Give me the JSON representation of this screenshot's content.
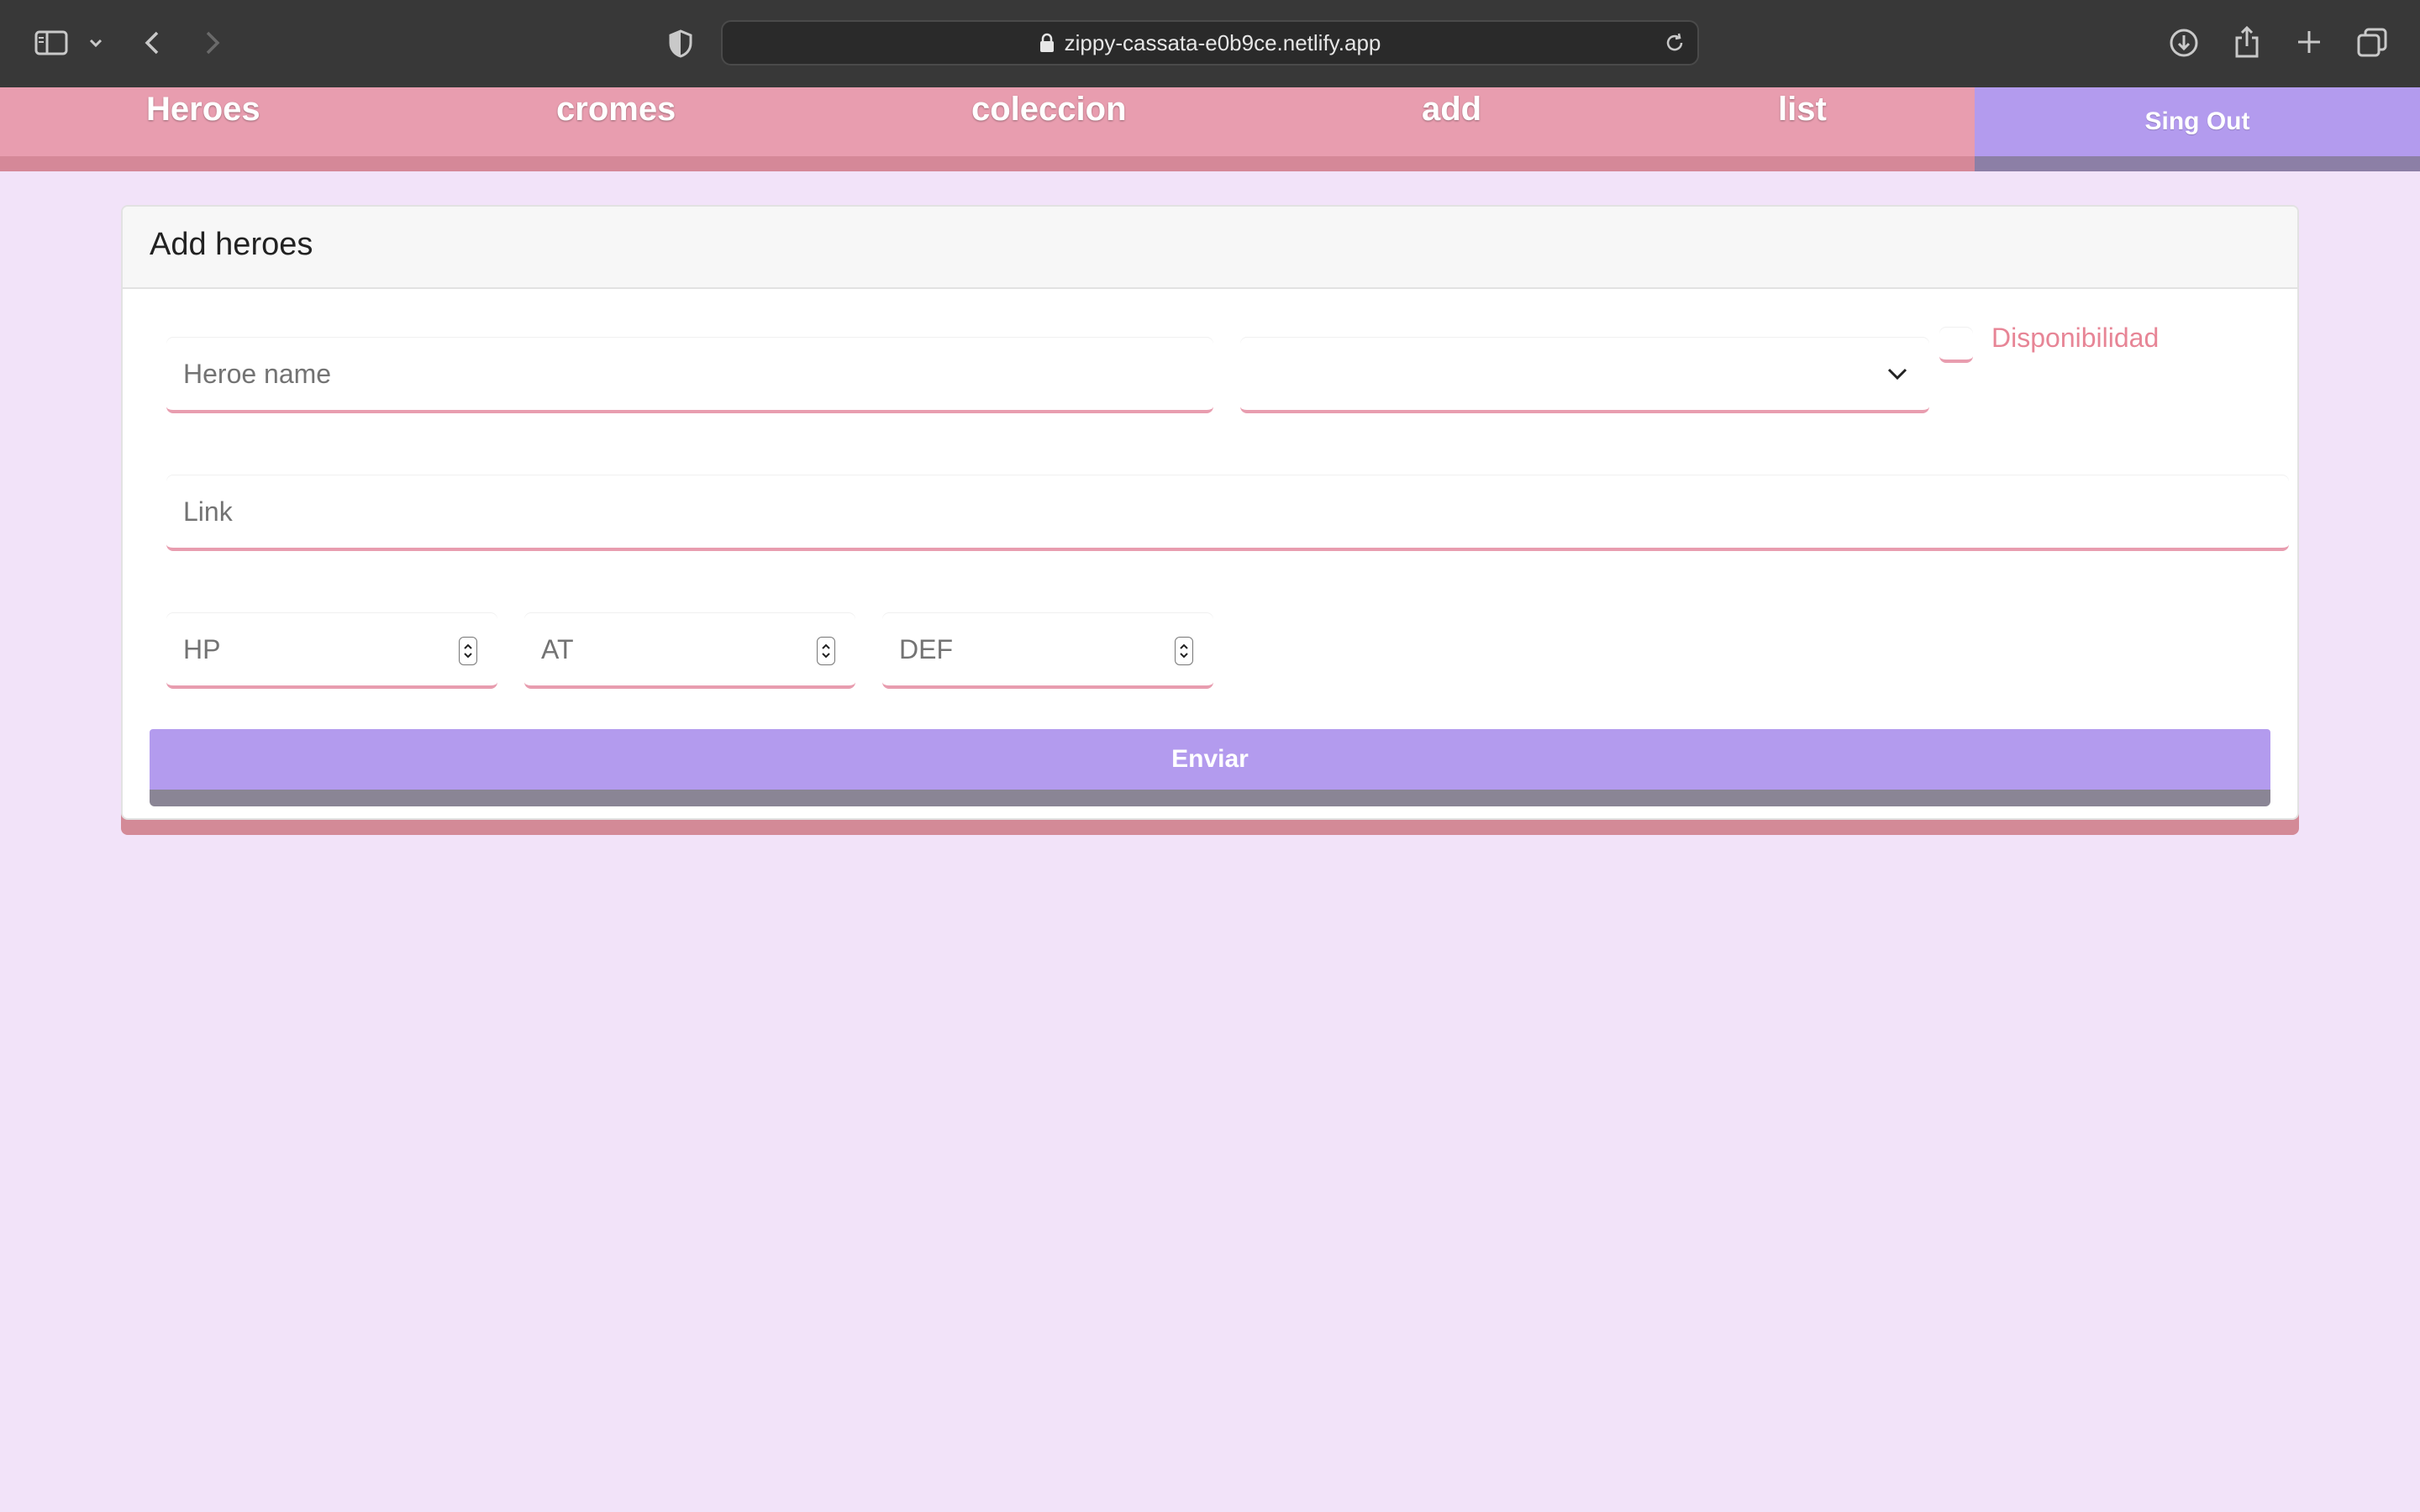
{
  "browser": {
    "url": "zippy-cassata-e0b9ce.netlify.app",
    "icons": [
      "sidebar-icon",
      "chevron-down-icon",
      "back-icon",
      "forward-icon",
      "shield-icon",
      "lock-icon",
      "reload-icon",
      "download-icon",
      "share-icon",
      "new-tab-icon",
      "tabs-overview-icon"
    ]
  },
  "nav": {
    "links": [
      "Heroes",
      "cromes",
      "coleccion",
      "add",
      "list"
    ],
    "signout_label": "Sing Out"
  },
  "card": {
    "title": "Add heroes"
  },
  "form": {
    "name_placeholder": "Heroe name",
    "company_value": "",
    "availability_label": "Disponibilidad",
    "link_placeholder": "Link",
    "hp_placeholder": "HP",
    "at_placeholder": "AT",
    "def_placeholder": "DEF",
    "submit_label": "Enviar"
  },
  "colors": {
    "page_background": "#f2e3f9",
    "nav_pink": "#e89daf",
    "accent_purple": "#b39bee",
    "label_pink": "#e78596"
  }
}
